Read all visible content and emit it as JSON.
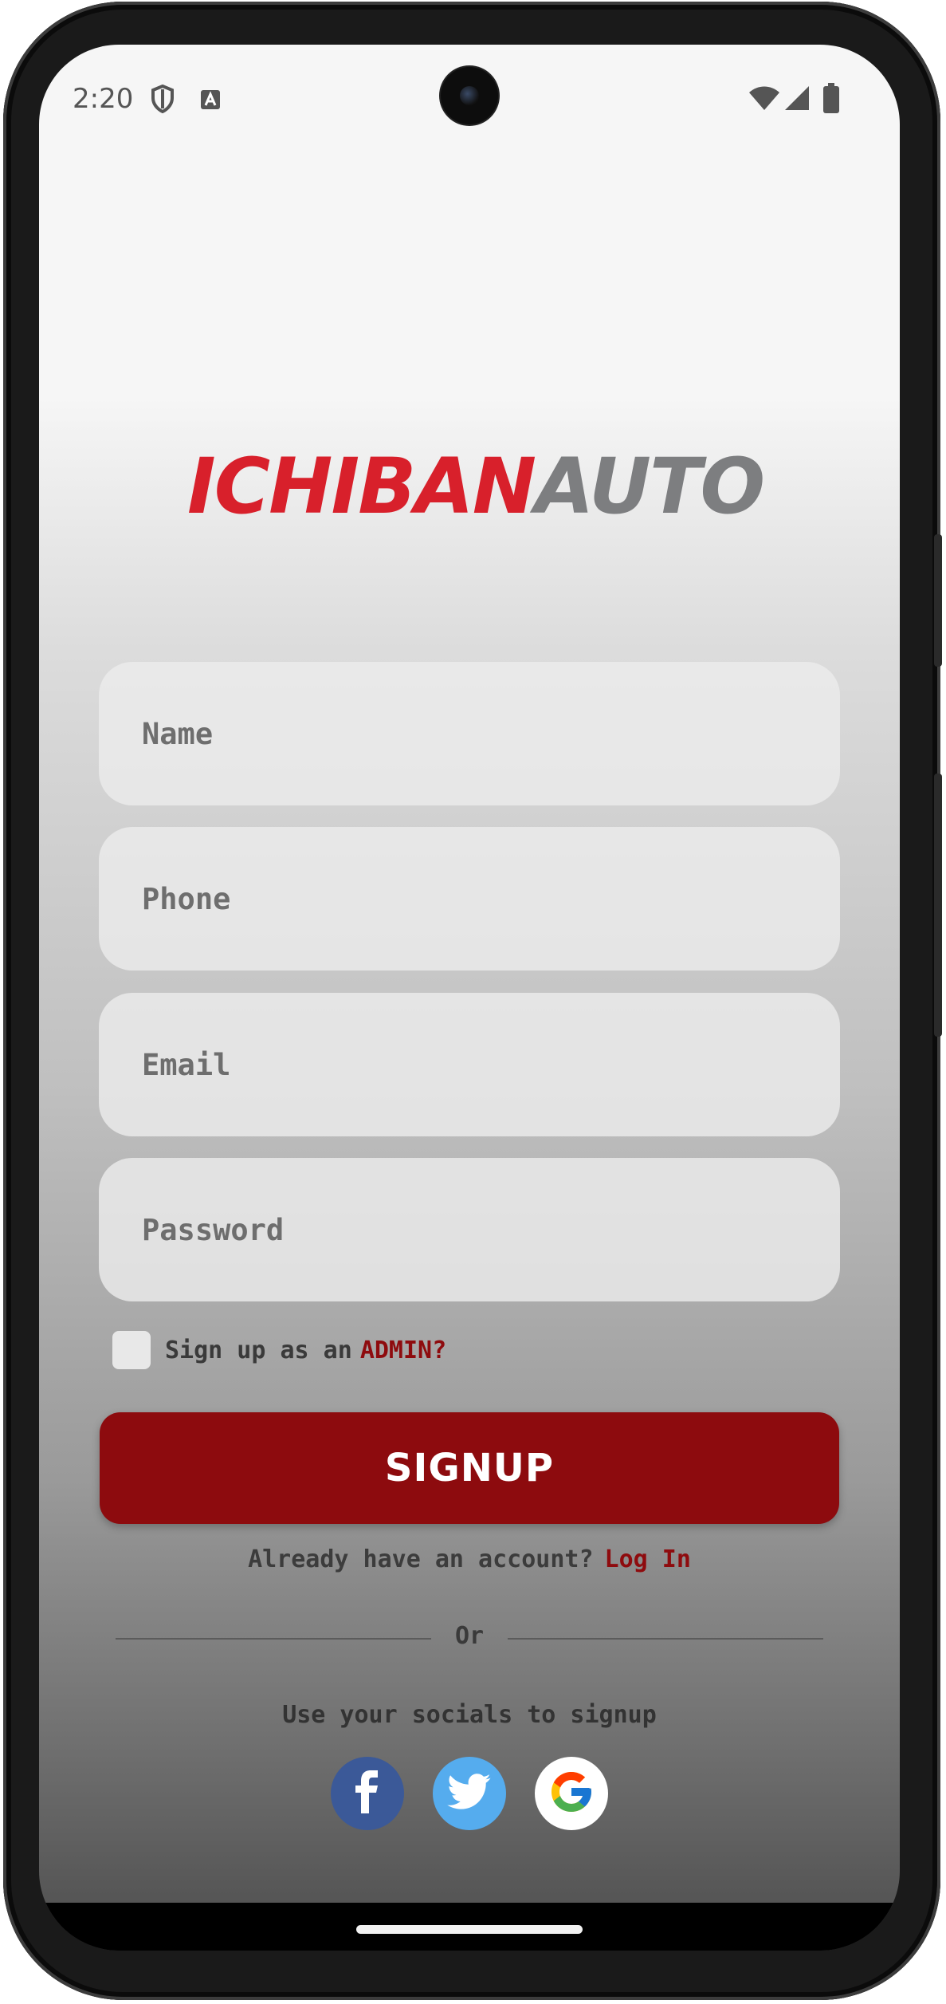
{
  "status_bar": {
    "time": "2:20",
    "icons": [
      "shield-icon",
      "text-a-icon",
      "wifi-icon",
      "signal-icon",
      "battery-icon"
    ]
  },
  "logo": {
    "part1": "ICHIBAN",
    "part2": "AUTO",
    "colors": {
      "part1": "#d8202b",
      "part2": "#7d7e80"
    }
  },
  "form": {
    "name_placeholder": "Name",
    "phone_placeholder": "Phone",
    "email_placeholder": "Email",
    "password_placeholder": "Password",
    "admin_prefix": "Sign up as an",
    "admin_link": "ADMIN?",
    "signup_label": "SIGNUP"
  },
  "login": {
    "prompt": "Already have an account?",
    "link": "Log In"
  },
  "divider_label": "Or",
  "socials": {
    "label": "Use your socials to signup",
    "items": [
      "facebook-icon",
      "twitter-icon",
      "google-icon"
    ]
  },
  "colors": {
    "accent": "#8d0b0e",
    "facebook": "#3b5998",
    "twitter": "#55acee"
  }
}
